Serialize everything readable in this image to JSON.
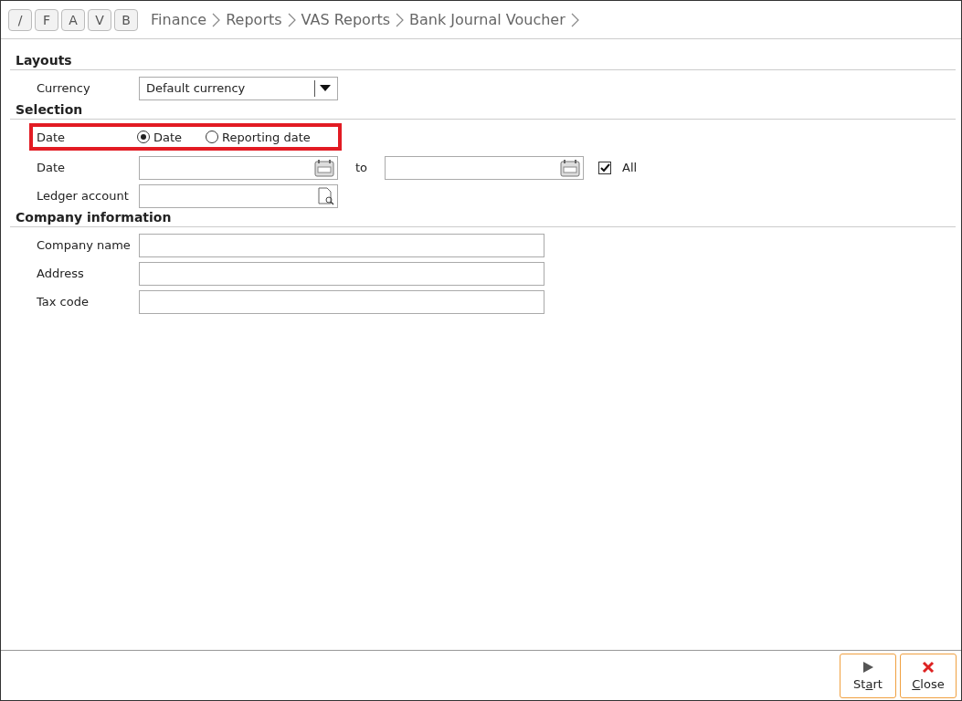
{
  "shortcuts": [
    "/",
    "F",
    "A",
    "V",
    "B"
  ],
  "breadcrumb": [
    "Finance",
    "Reports",
    "VAS Reports",
    "Bank Journal Voucher"
  ],
  "sections": [
    {
      "title": "Layouts",
      "rows": [
        {
          "kind": "dropdown",
          "label": "Currency",
          "value": "Default currency"
        }
      ]
    },
    {
      "title": "Selection",
      "rows": [
        {
          "kind": "radio",
          "label": "Date",
          "highlighted": true,
          "options": [
            {
              "label": "Date",
              "selected": true
            },
            {
              "label": "Reporting date",
              "selected": false
            }
          ]
        },
        {
          "kind": "daterange",
          "label": "Date",
          "to_label": "to",
          "all": {
            "label": "All",
            "checked": true
          }
        },
        {
          "kind": "lookup",
          "label": "Ledger account"
        }
      ]
    },
    {
      "title": "Company information",
      "rows": [
        {
          "kind": "text",
          "label": "Company name"
        },
        {
          "kind": "text",
          "label": "Address"
        },
        {
          "kind": "text",
          "label": "Tax code"
        }
      ]
    }
  ],
  "buttons": [
    {
      "kind": "start",
      "label_before_key": "St",
      "access_key": "a",
      "label_after_key": "rt"
    },
    {
      "kind": "close",
      "access_key": "C",
      "label_after_key": "lose"
    }
  ]
}
